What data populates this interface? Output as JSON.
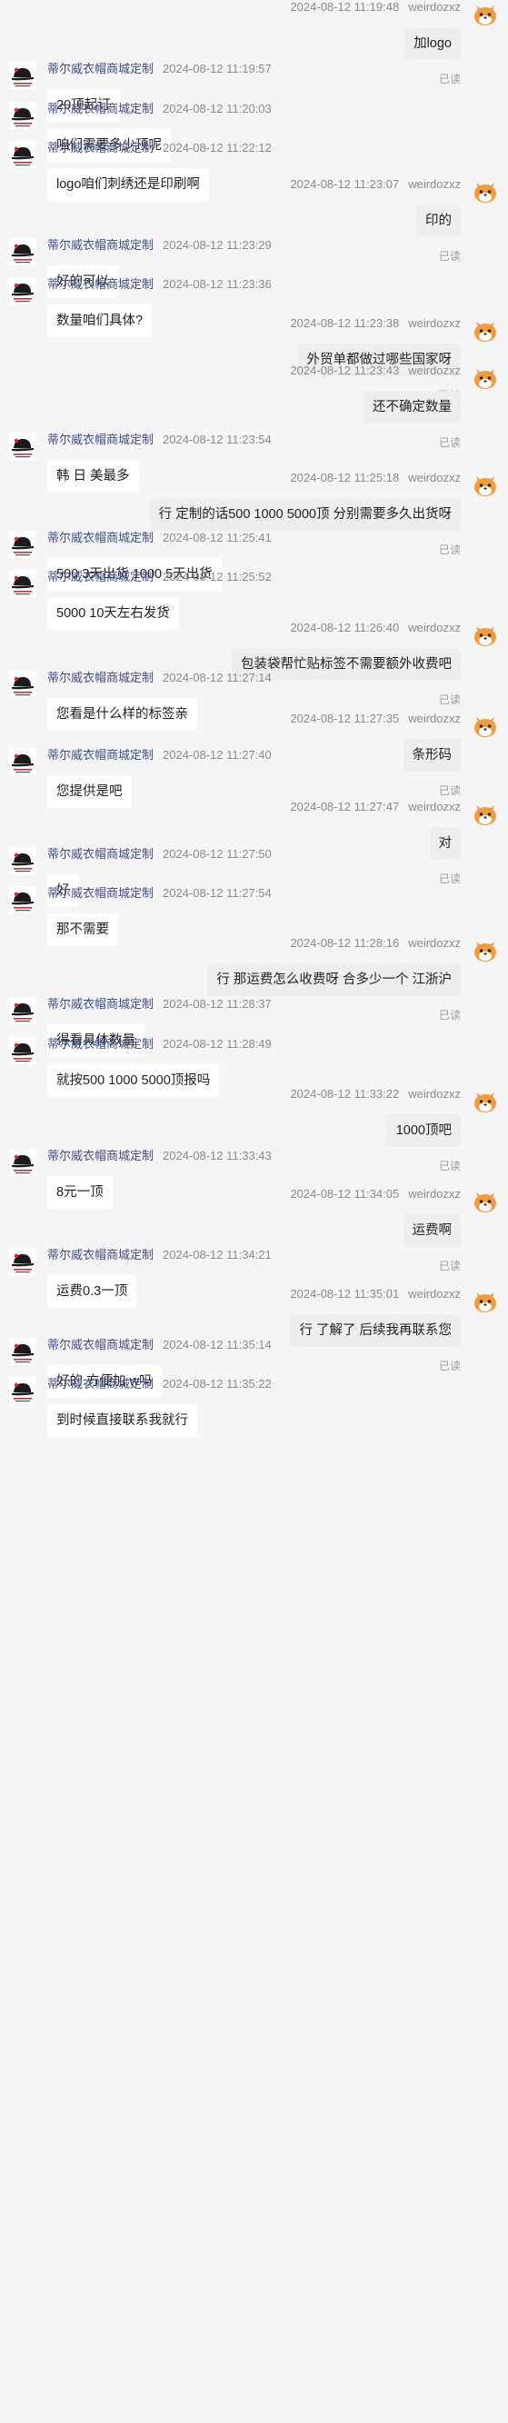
{
  "seller": {
    "name": "蒂尔威衣帽商城定制"
  },
  "buyer": {
    "name": "weirdozxz"
  },
  "read_label": "已读",
  "messages": [
    {
      "dir": "out",
      "time": "2024-08-12 11:19:48",
      "text": "加logo",
      "read": true
    },
    {
      "dir": "in",
      "time": "2024-08-12 11:19:57",
      "text": "20顶起订"
    },
    {
      "dir": "in",
      "time": "2024-08-12 11:20:03",
      "text": "咱们需要多少顶呢"
    },
    {
      "dir": "in",
      "time": "2024-08-12 11:22:12",
      "text": "logo咱们刺绣还是印刷啊"
    },
    {
      "dir": "out",
      "time": "2024-08-12 11:23:07",
      "text": "印的",
      "read": true
    },
    {
      "dir": "in",
      "time": "2024-08-12 11:23:29",
      "text": "好的可以"
    },
    {
      "dir": "in",
      "time": "2024-08-12 11:23:36",
      "text": "数量咱们具体?"
    },
    {
      "dir": "out",
      "time": "2024-08-12 11:23:38",
      "text": "外贸单都做过哪些国家呀",
      "read": true
    },
    {
      "dir": "out",
      "time": "2024-08-12 11:23:43",
      "text": "还不确定数量",
      "read": true
    },
    {
      "dir": "in",
      "time": "2024-08-12 11:23:54",
      "text": "韩 日 美最多"
    },
    {
      "dir": "out",
      "time": "2024-08-12 11:25:18",
      "text": "行 定制的话500 1000 5000顶 分别需要多久出货呀",
      "read": true
    },
    {
      "dir": "in",
      "time": "2024-08-12 11:25:41",
      "text": "500 3天出货 1000 5天出货"
    },
    {
      "dir": "in",
      "time": "2024-08-12 11:25:52",
      "text": "5000 10天左右发货"
    },
    {
      "dir": "out",
      "time": "2024-08-12 11:26:40",
      "text": "包装袋帮忙贴标签不需要额外收费吧",
      "read": true
    },
    {
      "dir": "in",
      "time": "2024-08-12 11:27:14",
      "text": "您看是什么样的标签亲"
    },
    {
      "dir": "out",
      "time": "2024-08-12 11:27:35",
      "text": "条形码",
      "read": true
    },
    {
      "dir": "in",
      "time": "2024-08-12 11:27:40",
      "text": "您提供是吧"
    },
    {
      "dir": "out",
      "time": "2024-08-12 11:27:47",
      "text": "对",
      "read": true
    },
    {
      "dir": "in",
      "time": "2024-08-12 11:27:50",
      "text": "好"
    },
    {
      "dir": "in",
      "time": "2024-08-12 11:27:54",
      "text": "那不需要"
    },
    {
      "dir": "out",
      "time": "2024-08-12 11:28:16",
      "text": "行 那运费怎么收费呀 合多少一个 江浙沪",
      "read": true
    },
    {
      "dir": "in",
      "time": "2024-08-12 11:28:37",
      "text": "得看具体数量"
    },
    {
      "dir": "in",
      "time": "2024-08-12 11:28:49",
      "text": "就按500 1000 5000顶报吗"
    },
    {
      "dir": "out",
      "time": "2024-08-12 11:33:22",
      "text": "1000顶吧",
      "read": true
    },
    {
      "dir": "in",
      "time": "2024-08-12 11:33:43",
      "text": "8元一顶"
    },
    {
      "dir": "out",
      "time": "2024-08-12 11:34:05",
      "text": "运费啊",
      "read": true
    },
    {
      "dir": "in",
      "time": "2024-08-12 11:34:21",
      "text": "运费0.3一顶"
    },
    {
      "dir": "out",
      "time": "2024-08-12 11:35:01",
      "text": "行 了解了 后续我再联系您",
      "read": true
    },
    {
      "dir": "in",
      "time": "2024-08-12 11:35:14",
      "text": "好的 方便加 w吗"
    },
    {
      "dir": "in",
      "time": "2024-08-12 11:35:22",
      "text": "到时候直接联系我就行"
    }
  ]
}
